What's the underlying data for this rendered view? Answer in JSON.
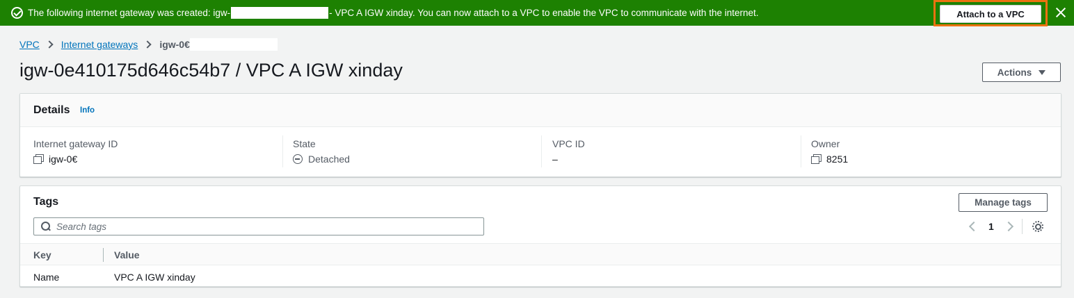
{
  "flash": {
    "message_prefix": "The following internet gateway was created: igw-",
    "message_suffix": "- VPC A IGW xinday. You can now attach to a VPC to enable the VPC to communicate with the internet.",
    "action_label": "Attach to a VPC",
    "color": "#1d8102",
    "highlight_color": "#ec7211"
  },
  "breadcrumb": {
    "items": [
      "VPC",
      "Internet gateways"
    ],
    "current": "igw-0€"
  },
  "page": {
    "title": "igw-0e410175d646c54b7 / VPC A IGW xinday",
    "actions_label": "Actions"
  },
  "details": {
    "heading": "Details",
    "info_label": "Info",
    "fields": [
      {
        "label": "Internet gateway ID",
        "value": "igw-0€",
        "icon": "copy-icon"
      },
      {
        "label": "State",
        "value": "Detached",
        "icon": "minus-circle-icon"
      },
      {
        "label": "VPC ID",
        "value": "–"
      },
      {
        "label": "Owner",
        "value": "8251",
        "icon": "copy-icon"
      }
    ]
  },
  "tags": {
    "heading": "Tags",
    "manage_label": "Manage tags",
    "search_placeholder": "Search tags",
    "current_page": "1",
    "columns": [
      "Key",
      "Value"
    ],
    "rows": [
      {
        "key": "Name",
        "value": "VPC A IGW xinday"
      }
    ]
  }
}
